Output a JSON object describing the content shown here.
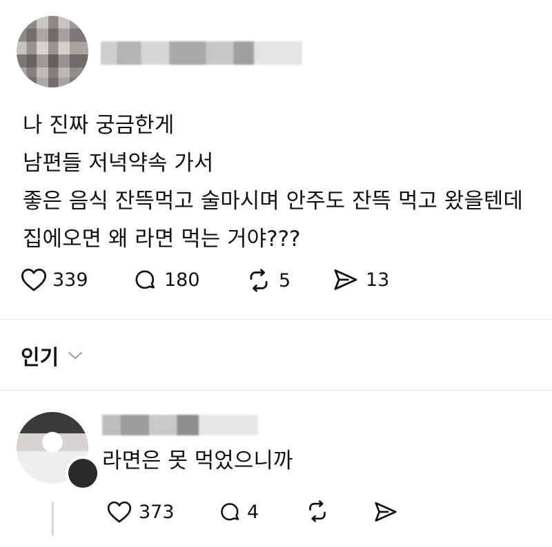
{
  "post": {
    "lines": [
      "나 진짜 궁금한게",
      "남편들 저녁약속 가서",
      "좋은 음식 잔뜩먹고 술마시며 안주도 잔뜩 먹고 왔을텐데",
      "집에오면 왜 라면 먹는 거야???"
    ],
    "likes": "339",
    "comments": "180",
    "reposts": "5",
    "shares": "13"
  },
  "sort": {
    "label": "인기"
  },
  "reply": {
    "text": "라면은 못 먹었으니까",
    "likes": "373",
    "comments": "4"
  },
  "icons": {
    "like": "heart-icon",
    "comment": "comment-bubble-icon",
    "repost": "repost-arrows-icon",
    "share": "send-paper-plane-icon",
    "sort": "chevron-down-icon"
  },
  "colors": {
    "text": "#111111",
    "divider": "#e6e6e6",
    "background": "#ffffff"
  }
}
